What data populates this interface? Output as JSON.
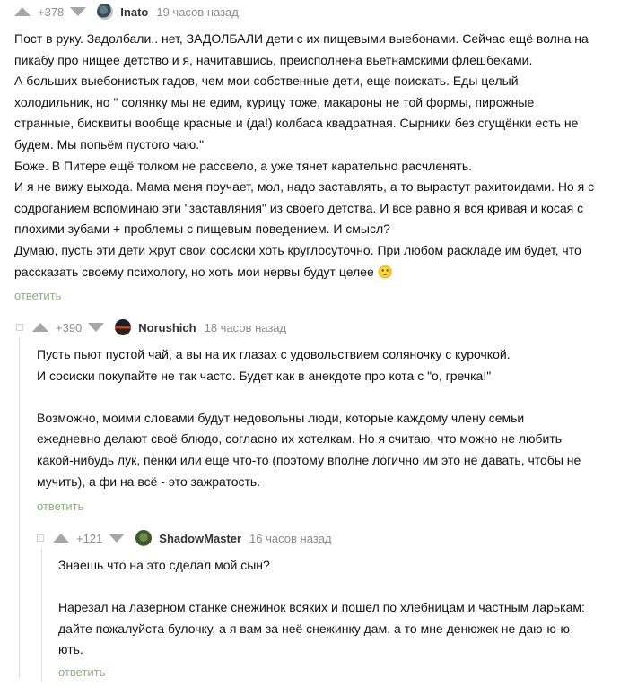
{
  "comments": [
    {
      "rating": "+378",
      "username": "Inato",
      "time": "19 часов назад",
      "lines": [
        "Пост в руку. Задолбали.. нет, ЗАДОЛБАЛИ дети с их пищевыми выебонами. Сейчас ещё волна на",
        "пикабу про нищее детство и я, начитавшись, преисполнена вьетнамскими флешбеками.",
        "А больших выебонистых гадов, чем мои собственные дети, еще поискать. Еды целый",
        "холодильник, но \" солянку мы не едим, курицу тоже, макароны не той формы, пирожные",
        "странные, бисквиты вообще красные и (да!) колбаса квадратная. Сырники без сгущёнки есть не",
        "будем. Мы попьём пустого чаю.\"",
        "Боже. В Питере ещё толком не рассвело, а уже тянет карательно расчленять.",
        "И я не вижу выхода. Мама меня поучает, мол, надо заставлять, а то вырастут рахитоидами. Но я с",
        "содроганием вспоминаю эти \"заставляния\" из своего детства. И все равно я вся кривая и косая с",
        "плохими зубами + проблемы с пищевым поведением. И смысл?",
        "Думаю, пусть эти дети жрут свои сосиски хоть круглосуточно. При любом раскладе им будет, что",
        "рассказать своему психологу, но хоть мои нервы будут целее 🙂"
      ],
      "reply": "ответить"
    },
    {
      "rating": "+390",
      "username": "Norushich",
      "time": "18 часов назад",
      "lines": [
        "Пусть пьют пустой чай, а вы на их глазах с удовольствием соляночку с курочкой.",
        "И сосиски покупайте не так часто. Будет как в анекдоте про кота с \"о, гречка!\"",
        "",
        "Возможно, моими словами будут недовольны люди, которые каждому члену семьи",
        "ежедневно делают своё блюдо, согласно их хотелкам. Но я считаю, что можно не любить",
        "какой-нибудь лук, пенки или еще что-то (поэтому вполне логично им это не давать, чтобы не",
        "мучить), а фи на всё - это зажратость."
      ],
      "reply": "ответить"
    },
    {
      "rating": "+121",
      "username": "ShadowMaster",
      "time": "16 часов назад",
      "lines": [
        "Знаешь что на это сделал мой сын?",
        "",
        "Нарезал на лазерном станке снежинок всяких и пошел по хлебницам и частным ларькам:",
        "дайте пожалуйста булочку, а я вам за неё снежинку дам, а то мне денюжек не даю-ю-ю-",
        "ють."
      ],
      "reply": "ответить"
    }
  ],
  "colors": {
    "reply_link": "#8ab27a",
    "meta_gray": "#8b8b8b",
    "vote_arrow": "#a6a6a6",
    "branch_line": "#dcdcdc"
  }
}
